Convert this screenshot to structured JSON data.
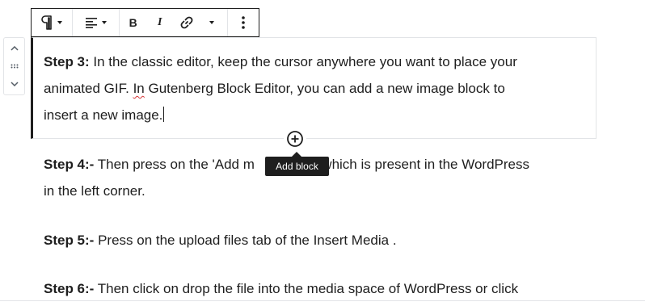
{
  "toolbar": {
    "paragraph_icon": "paragraph-icon",
    "align_icon": "align-left-icon",
    "bold_label": "B",
    "italic_label": "I",
    "link_icon": "link-icon",
    "more_icon": "more-vertical-icon"
  },
  "mover": {
    "up_icon": "chevron-up-icon",
    "drag_icon": "drag-handle-icon",
    "down_icon": "chevron-down-icon"
  },
  "content": {
    "step3": {
      "label": "Step 3:",
      "text_a": " In the classic editor, keep the cursor anywhere you want to place your",
      "line2_pre": "animated GIF. ",
      "line2_underlined": "In",
      "line2_post": " Gutenberg Block Editor, you can add a new image block to",
      "line3": "insert a new image."
    },
    "step4": {
      "label": "Step 4:-",
      "line1_a": " Then press on the 'Add m",
      "line1_b": "ion which is present in the WordPress",
      "line2": "in the left corner."
    },
    "step5": {
      "label": "Step 5:-",
      "text": " Press on the upload files tab of the Insert Media ."
    },
    "step6": {
      "label": "Step 6:-",
      "text": " Then click on drop the file into the media space of WordPress or click"
    }
  },
  "inserter": {
    "icon": "plus-circle-icon",
    "tooltip": "Add block"
  },
  "colors": {
    "text": "#1e1e1e",
    "border": "#e2e4e7",
    "tooltip_bg": "#1e1e1e",
    "spellcheck": "#d63638"
  }
}
